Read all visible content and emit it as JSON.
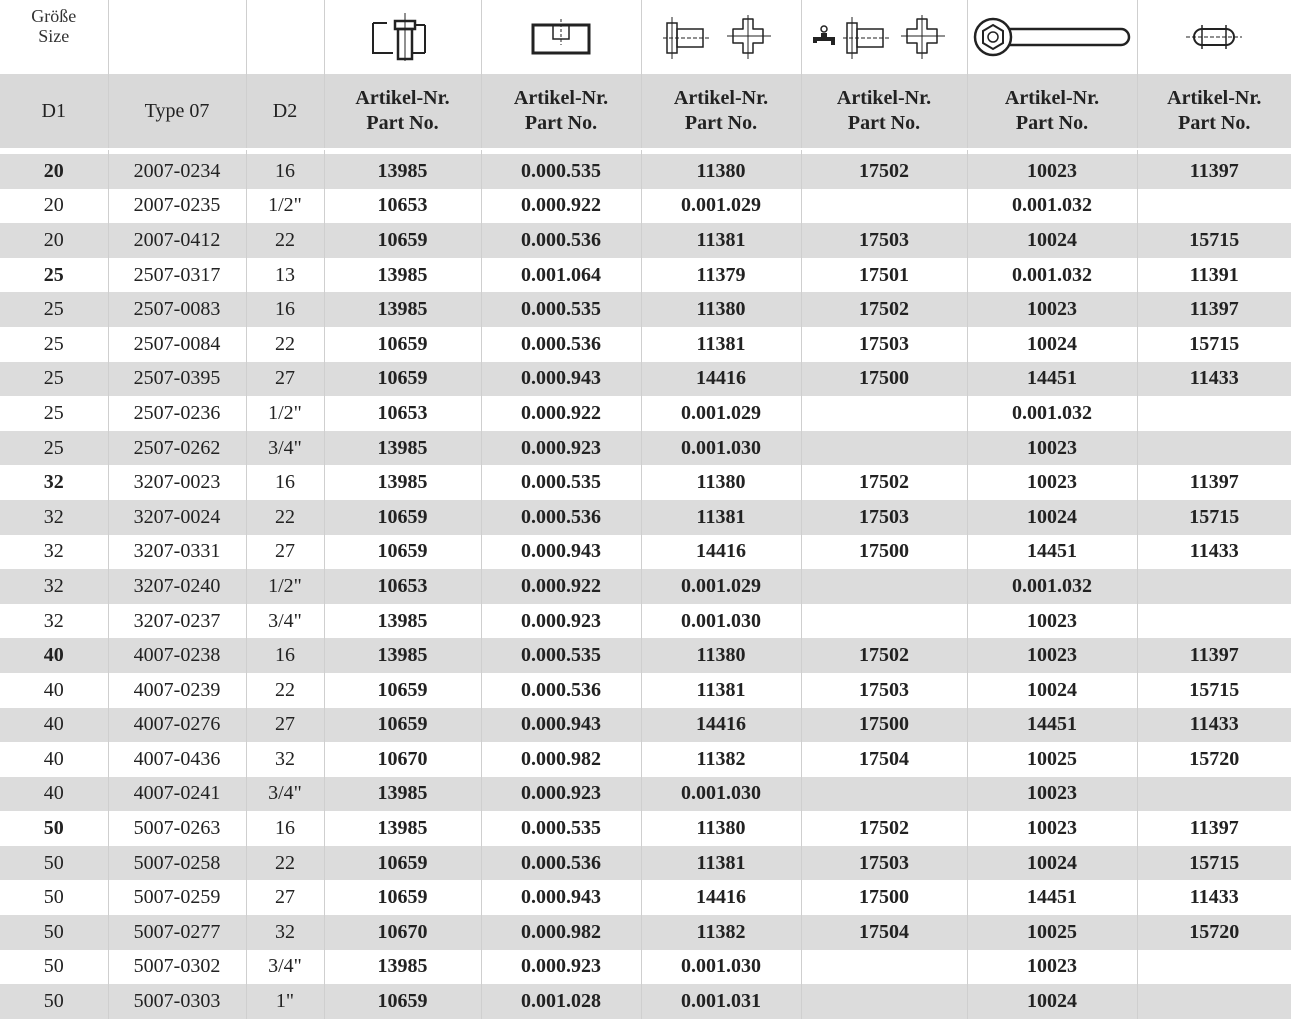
{
  "header": {
    "size_label_de": "Größe",
    "size_label_en": "Size",
    "col_d1": "D1",
    "col_type": "Type 07",
    "col_d2": "D2",
    "part_label_de": "Artikel-Nr.",
    "part_label_en": "Part No.",
    "icons": [
      "shaft-seal-drawing-icon",
      "bore-plug-drawing-icon",
      "spigot-and-cross-drawing-icon",
      "faucet-spigot-cross-drawing-icon",
      "ring-wrench-icon",
      "flat-oval-pin-icon"
    ]
  },
  "rows": [
    {
      "d1": "20",
      "first": true,
      "type": "2007-0234",
      "d2": "16",
      "p1": "13985",
      "p2": "0.000.535",
      "p3": "11380",
      "p4": "17502",
      "p5": "10023",
      "p6": "11397"
    },
    {
      "d1": "20",
      "first": false,
      "type": "2007-0235",
      "d2": "1/2\"",
      "p1": "10653",
      "p2": "0.000.922",
      "p3": "0.001.029",
      "p4": "",
      "p5": "0.001.032",
      "p6": ""
    },
    {
      "d1": "20",
      "first": false,
      "type": "2007-0412",
      "d2": "22",
      "p1": "10659",
      "p2": "0.000.536",
      "p3": "11381",
      "p4": "17503",
      "p5": "10024",
      "p6": "15715"
    },
    {
      "d1": "25",
      "first": true,
      "type": "2507-0317",
      "d2": "13",
      "p1": "13985",
      "p2": "0.001.064",
      "p3": "11379",
      "p4": "17501",
      "p5": "0.001.032",
      "p6": "11391"
    },
    {
      "d1": "25",
      "first": false,
      "type": "2507-0083",
      "d2": "16",
      "p1": "13985",
      "p2": "0.000.535",
      "p3": "11380",
      "p4": "17502",
      "p5": "10023",
      "p6": "11397"
    },
    {
      "d1": "25",
      "first": false,
      "type": "2507-0084",
      "d2": "22",
      "p1": "10659",
      "p2": "0.000.536",
      "p3": "11381",
      "p4": "17503",
      "p5": "10024",
      "p6": "15715"
    },
    {
      "d1": "25",
      "first": false,
      "type": "2507-0395",
      "d2": "27",
      "p1": "10659",
      "p2": "0.000.943",
      "p3": "14416",
      "p4": "17500",
      "p5": "14451",
      "p6": "11433"
    },
    {
      "d1": "25",
      "first": false,
      "type": "2507-0236",
      "d2": "1/2\"",
      "p1": "10653",
      "p2": "0.000.922",
      "p3": "0.001.029",
      "p4": "",
      "p5": "0.001.032",
      "p6": ""
    },
    {
      "d1": "25",
      "first": false,
      "type": "2507-0262",
      "d2": "3/4\"",
      "p1": "13985",
      "p2": "0.000.923",
      "p3": "0.001.030",
      "p4": "",
      "p5": "10023",
      "p6": ""
    },
    {
      "d1": "32",
      "first": true,
      "type": "3207-0023",
      "d2": "16",
      "p1": "13985",
      "p2": "0.000.535",
      "p3": "11380",
      "p4": "17502",
      "p5": "10023",
      "p6": "11397"
    },
    {
      "d1": "32",
      "first": false,
      "type": "3207-0024",
      "d2": "22",
      "p1": "10659",
      "p2": "0.000.536",
      "p3": "11381",
      "p4": "17503",
      "p5": "10024",
      "p6": "15715"
    },
    {
      "d1": "32",
      "first": false,
      "type": "3207-0331",
      "d2": "27",
      "p1": "10659",
      "p2": "0.000.943",
      "p3": "14416",
      "p4": "17500",
      "p5": "14451",
      "p6": "11433"
    },
    {
      "d1": "32",
      "first": false,
      "type": "3207-0240",
      "d2": "1/2\"",
      "p1": "10653",
      "p2": "0.000.922",
      "p3": "0.001.029",
      "p4": "",
      "p5": "0.001.032",
      "p6": ""
    },
    {
      "d1": "32",
      "first": false,
      "type": "3207-0237",
      "d2": "3/4\"",
      "p1": "13985",
      "p2": "0.000.923",
      "p3": "0.001.030",
      "p4": "",
      "p5": "10023",
      "p6": ""
    },
    {
      "d1": "40",
      "first": true,
      "type": "4007-0238",
      "d2": "16",
      "p1": "13985",
      "p2": "0.000.535",
      "p3": "11380",
      "p4": "17502",
      "p5": "10023",
      "p6": "11397"
    },
    {
      "d1": "40",
      "first": false,
      "type": "4007-0239",
      "d2": "22",
      "p1": "10659",
      "p2": "0.000.536",
      "p3": "11381",
      "p4": "17503",
      "p5": "10024",
      "p6": "15715"
    },
    {
      "d1": "40",
      "first": false,
      "type": "4007-0276",
      "d2": "27",
      "p1": "10659",
      "p2": "0.000.943",
      "p3": "14416",
      "p4": "17500",
      "p5": "14451",
      "p6": "11433"
    },
    {
      "d1": "40",
      "first": false,
      "type": "4007-0436",
      "d2": "32",
      "p1": "10670",
      "p2": "0.000.982",
      "p3": "11382",
      "p4": "17504",
      "p5": "10025",
      "p6": "15720"
    },
    {
      "d1": "40",
      "first": false,
      "type": "4007-0241",
      "d2": "3/4\"",
      "p1": "13985",
      "p2": "0.000.923",
      "p3": "0.001.030",
      "p4": "",
      "p5": "10023",
      "p6": ""
    },
    {
      "d1": "50",
      "first": true,
      "type": "5007-0263",
      "d2": "16",
      "p1": "13985",
      "p2": "0.000.535",
      "p3": "11380",
      "p4": "17502",
      "p5": "10023",
      "p6": "11397"
    },
    {
      "d1": "50",
      "first": false,
      "type": "5007-0258",
      "d2": "22",
      "p1": "10659",
      "p2": "0.000.536",
      "p3": "11381",
      "p4": "17503",
      "p5": "10024",
      "p6": "15715"
    },
    {
      "d1": "50",
      "first": false,
      "type": "5007-0259",
      "d2": "27",
      "p1": "10659",
      "p2": "0.000.943",
      "p3": "14416",
      "p4": "17500",
      "p5": "14451",
      "p6": "11433"
    },
    {
      "d1": "50",
      "first": false,
      "type": "5007-0277",
      "d2": "32",
      "p1": "10670",
      "p2": "0.000.982",
      "p3": "11382",
      "p4": "17504",
      "p5": "10025",
      "p6": "15720"
    },
    {
      "d1": "50",
      "first": false,
      "type": "5007-0302",
      "d2": "3/4\"",
      "p1": "13985",
      "p2": "0.000.923",
      "p3": "0.001.030",
      "p4": "",
      "p5": "10023",
      "p6": ""
    },
    {
      "d1": "50",
      "first": false,
      "type": "5007-0303",
      "d2": "1\"",
      "p1": "10659",
      "p2": "0.001.028",
      "p3": "0.001.031",
      "p4": "",
      "p5": "10024",
      "p6": ""
    }
  ]
}
